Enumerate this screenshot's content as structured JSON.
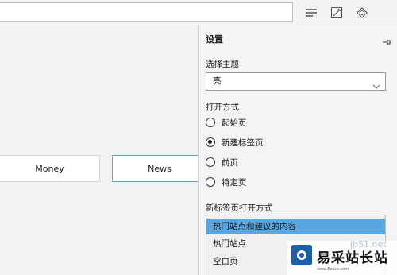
{
  "settings": {
    "title": "设置",
    "theme_label": "选择主题",
    "theme_value": "亮",
    "open_with_label": "打开方式",
    "open_with_options": [
      {
        "label": "起始页",
        "checked": false
      },
      {
        "label": "新建标签页",
        "checked": true
      },
      {
        "label": "前页",
        "checked": false
      },
      {
        "label": "特定页",
        "checked": false
      }
    ],
    "new_tab_label": "新标签页打开方式",
    "new_tab_options": [
      {
        "label": "热门站点和建议的内容",
        "selected": true
      },
      {
        "label": "热门站点",
        "selected": false
      },
      {
        "label": "空白页",
        "selected": false
      }
    ]
  },
  "tiles": [
    {
      "label": "Money"
    },
    {
      "label": "News"
    }
  ],
  "toolbar": {
    "icons": [
      "hub-icon",
      "web-note-icon",
      "share-icon"
    ]
  },
  "watermark": {
    "brand": "易采站长站",
    "faint": "jb51.net",
    "small": "www.Easck.com"
  },
  "colors": {
    "selection": "#5aa6e0",
    "news_border": "#6aa0d8"
  }
}
